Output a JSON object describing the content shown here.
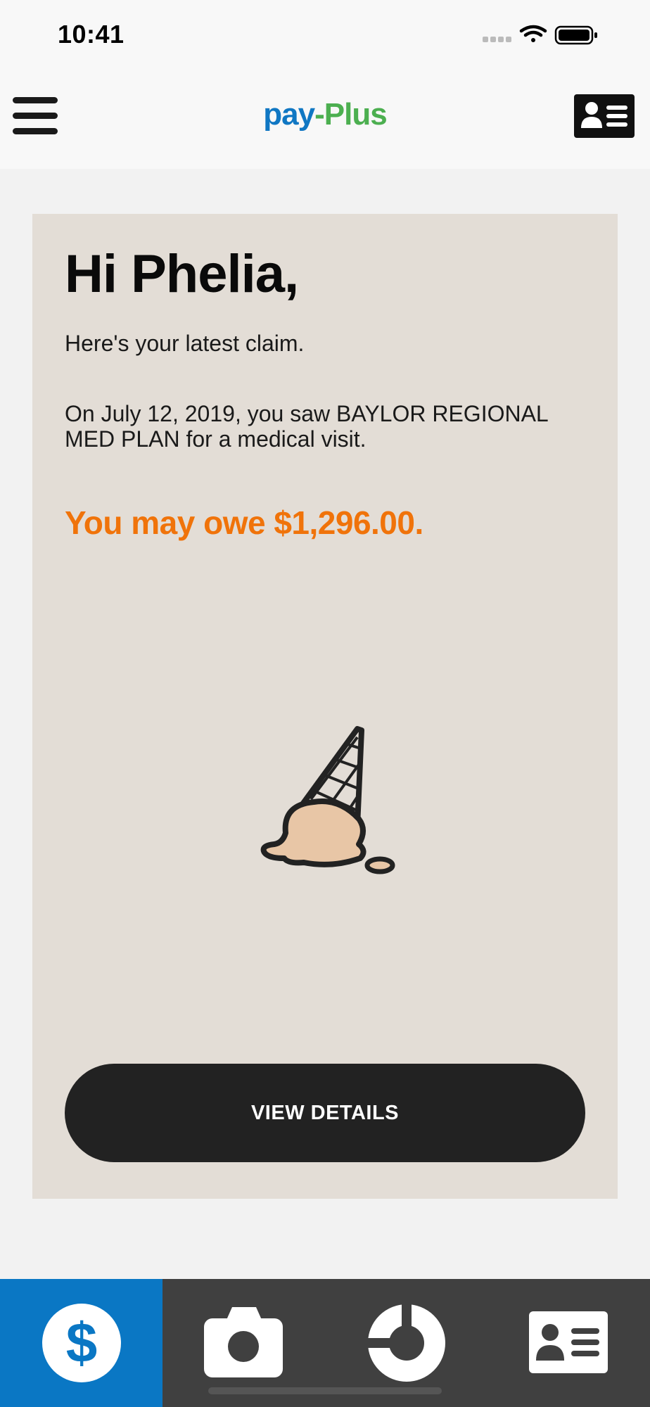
{
  "status_bar": {
    "time": "10:41",
    "icons": [
      "cellular-signal-icon",
      "wifi-icon",
      "battery-icon"
    ]
  },
  "header": {
    "logo": {
      "part1": "pay",
      "separator": "-",
      "part2": "Plus"
    },
    "menu_icon": "hamburger-menu-icon",
    "id_card_icon": "id-card-icon"
  },
  "card": {
    "greeting": "Hi Phelia,",
    "intro": "Here's your latest claim.",
    "claim_text": "On July 12, 2019, you saw BAYLOR REGIONAL MED PLAN for a medical visit.",
    "owe_text": "You may owe $1,296.00.",
    "illustration": "dropped-ice-cream-cone",
    "button_label": "VIEW DETAILS"
  },
  "bottom_nav": {
    "items": [
      {
        "icon": "dollar-icon",
        "active": true
      },
      {
        "icon": "camera-icon",
        "active": false
      },
      {
        "icon": "progress-ring-icon",
        "active": false
      },
      {
        "icon": "id-card-icon",
        "active": false
      }
    ]
  },
  "colors": {
    "accent_orange": "#f0730a",
    "brand_blue": "#1077c3",
    "brand_green": "#4caf50",
    "card_bg": "#e3ddd6",
    "nav_active": "#0a77c4",
    "nav_bg": "#404040"
  }
}
